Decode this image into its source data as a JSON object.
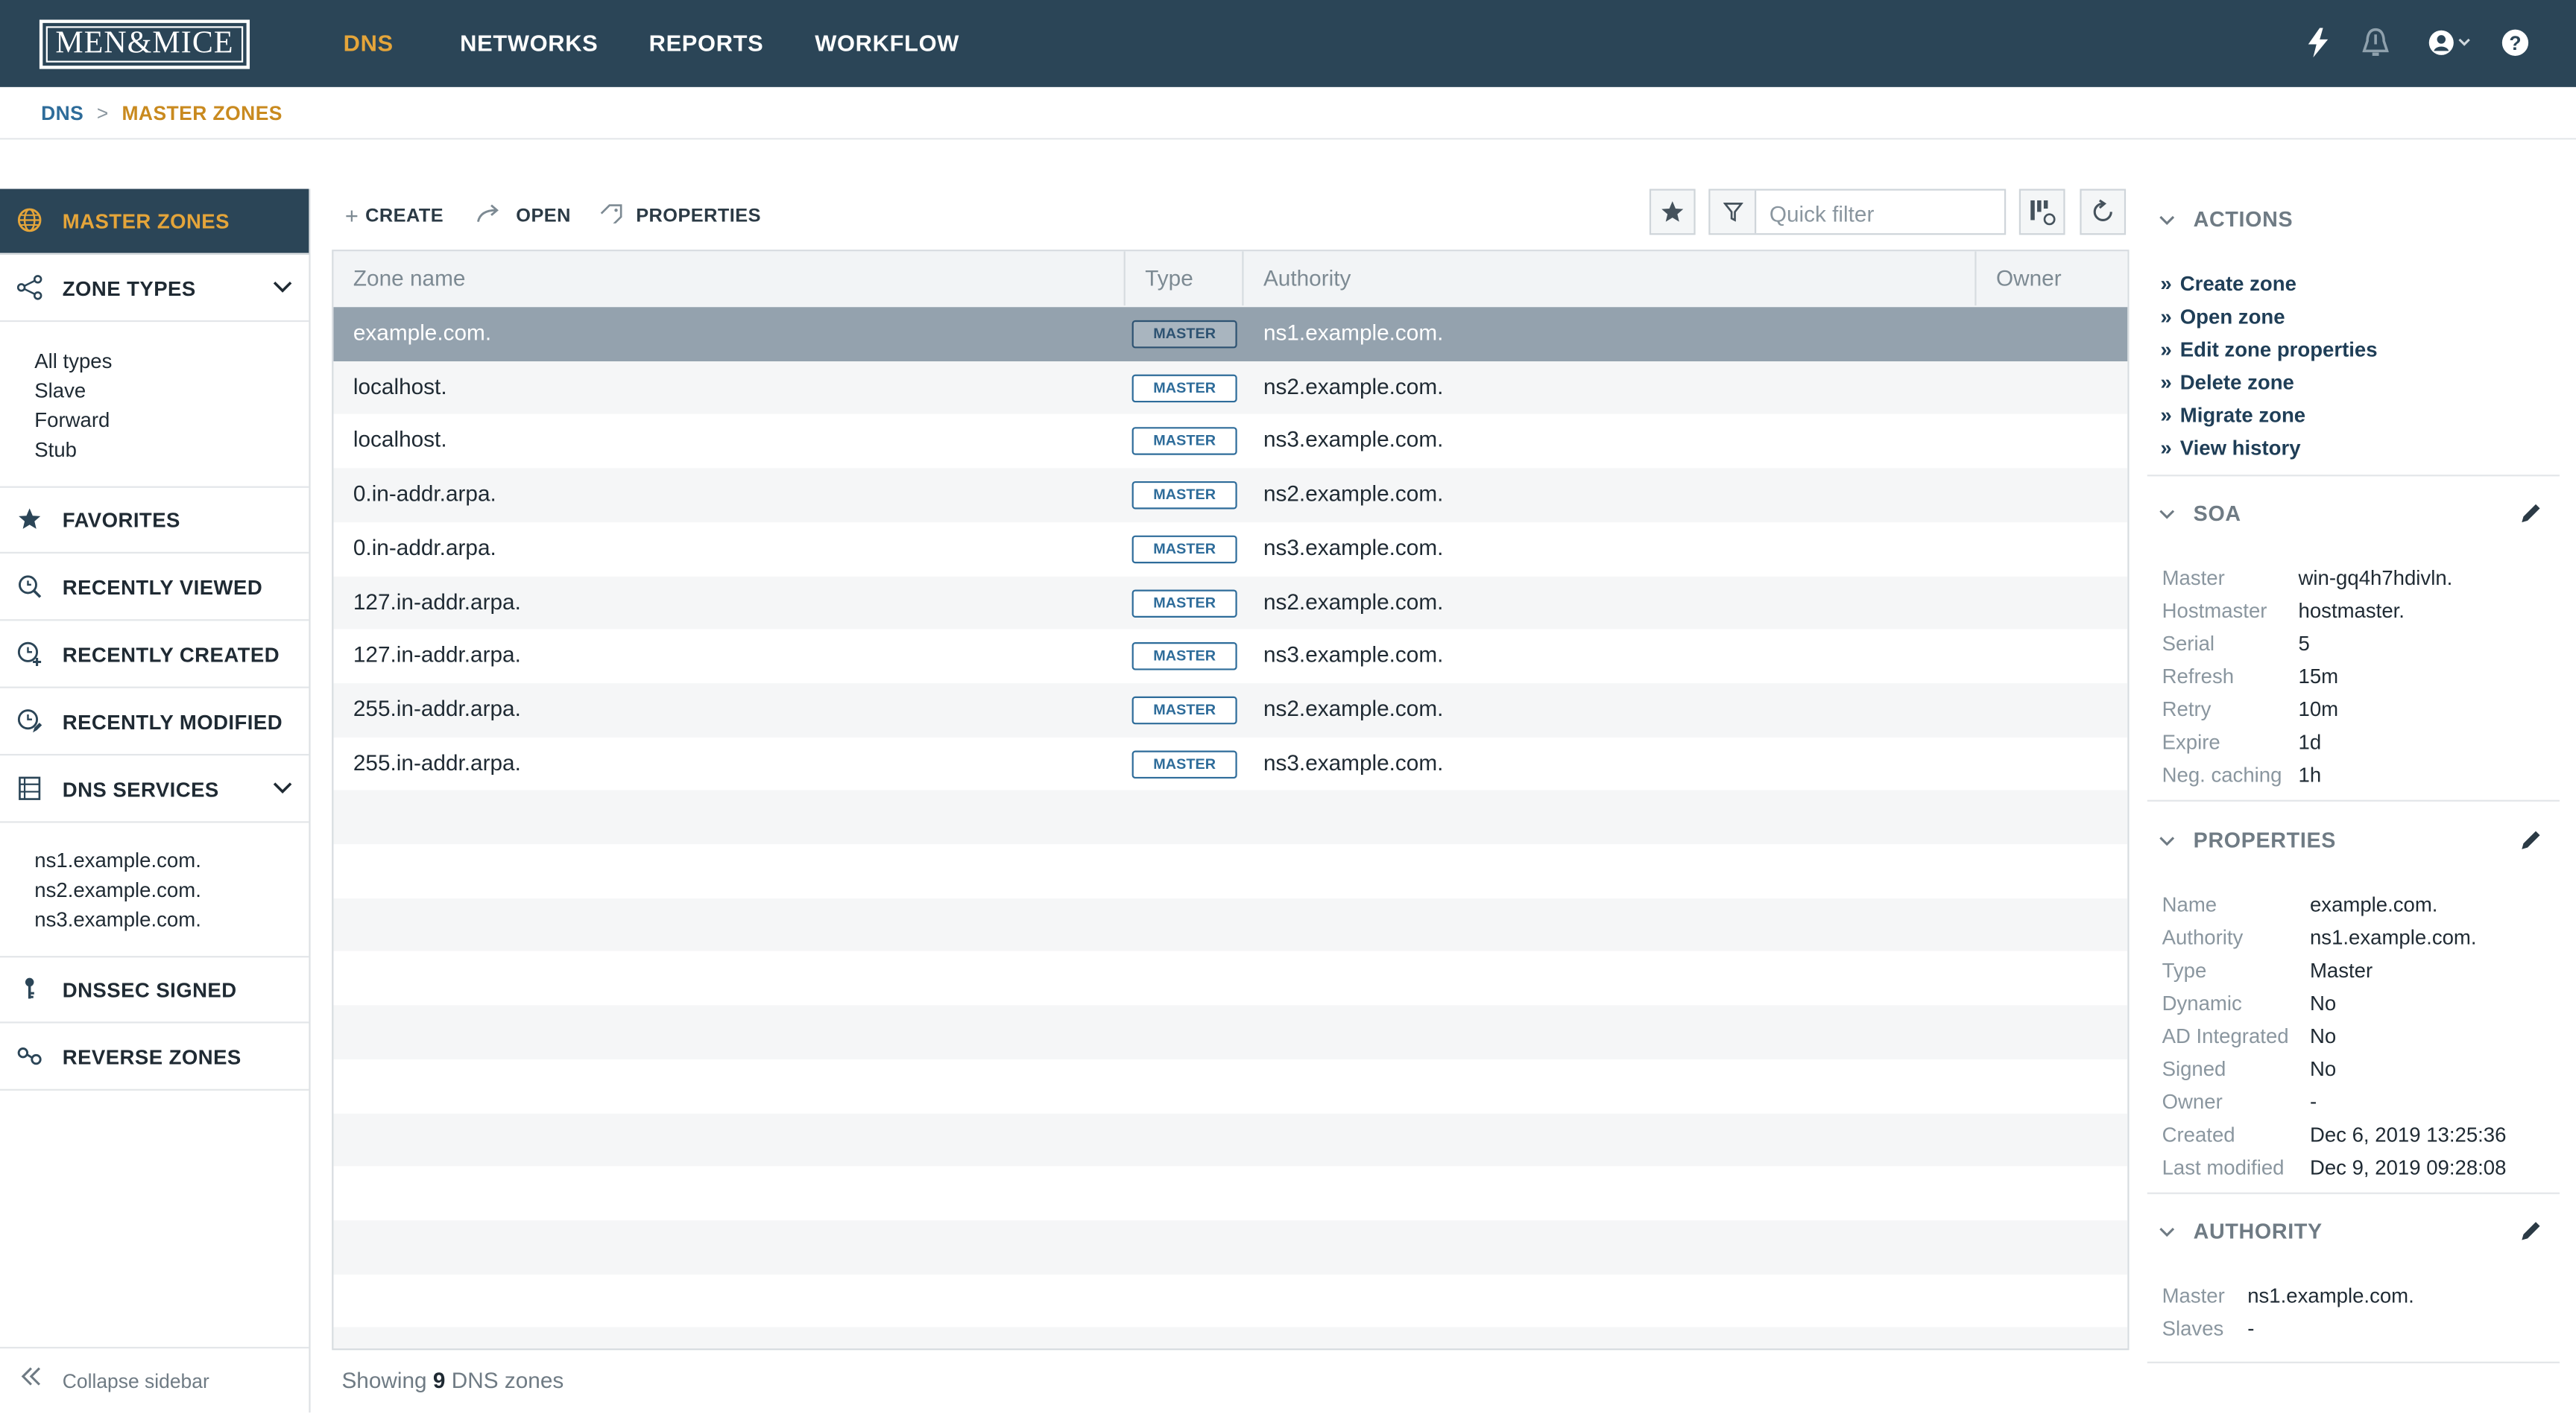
{
  "header": {
    "logo": "MEN&MICE",
    "nav": [
      "DNS",
      "NETWORKS",
      "REPORTS",
      "WORKFLOW"
    ],
    "active_nav": "DNS",
    "icons": [
      "lightning-icon",
      "bell-icon",
      "user-icon",
      "help-icon"
    ]
  },
  "breadcrumb": {
    "root": "DNS",
    "separator": ">",
    "current": "MASTER ZONES"
  },
  "sidebar": {
    "master_zones": "MASTER ZONES",
    "zone_types": {
      "label": "ZONE TYPES",
      "items": [
        "All types",
        "Slave",
        "Forward",
        "Stub"
      ]
    },
    "favorites": "FAVORITES",
    "recently_viewed": "RECENTLY VIEWED",
    "recently_created": "RECENTLY CREATED",
    "recently_modified": "RECENTLY MODIFIED",
    "dns_services": {
      "label": "DNS SERVICES",
      "items": [
        "ns1.example.com.",
        "ns2.example.com.",
        "ns3.example.com."
      ]
    },
    "dnssec_signed": "DNSSEC SIGNED",
    "reverse_zones": "REVERSE ZONES",
    "collapse": "Collapse sidebar"
  },
  "toolbar": {
    "create": "CREATE",
    "open": "OPEN",
    "properties": "PROPERTIES",
    "filter_placeholder": "Quick filter"
  },
  "grid": {
    "columns": [
      "Zone name",
      "Type",
      "Authority",
      "Owner"
    ],
    "rows": [
      {
        "zone": "example.com.",
        "type": "MASTER",
        "authority": "ns1.example.com.",
        "owner": ""
      },
      {
        "zone": "localhost.",
        "type": "MASTER",
        "authority": "ns2.example.com.",
        "owner": ""
      },
      {
        "zone": "localhost.",
        "type": "MASTER",
        "authority": "ns3.example.com.",
        "owner": ""
      },
      {
        "zone": "0.in-addr.arpa.",
        "type": "MASTER",
        "authority": "ns2.example.com.",
        "owner": ""
      },
      {
        "zone": "0.in-addr.arpa.",
        "type": "MASTER",
        "authority": "ns3.example.com.",
        "owner": ""
      },
      {
        "zone": "127.in-addr.arpa.",
        "type": "MASTER",
        "authority": "ns2.example.com.",
        "owner": ""
      },
      {
        "zone": "127.in-addr.arpa.",
        "type": "MASTER",
        "authority": "ns3.example.com.",
        "owner": ""
      },
      {
        "zone": "255.in-addr.arpa.",
        "type": "MASTER",
        "authority": "ns2.example.com.",
        "owner": ""
      },
      {
        "zone": "255.in-addr.arpa.",
        "type": "MASTER",
        "authority": "ns3.example.com.",
        "owner": ""
      }
    ],
    "selected_row": 0
  },
  "status": {
    "prefix": "Showing",
    "count": "9",
    "suffix": "DNS zones"
  },
  "actions": {
    "title": "ACTIONS",
    "items": [
      "Create zone",
      "Open zone",
      "Edit zone properties",
      "Delete zone",
      "Migrate zone",
      "View history"
    ]
  },
  "soa": {
    "title": "SOA",
    "fields": [
      {
        "k": "Master",
        "v": "win-gq4h7hdivln."
      },
      {
        "k": "Hostmaster",
        "v": "hostmaster."
      },
      {
        "k": "Serial",
        "v": "5"
      },
      {
        "k": "Refresh",
        "v": "15m"
      },
      {
        "k": "Retry",
        "v": "10m"
      },
      {
        "k": "Expire",
        "v": "1d"
      },
      {
        "k": "Neg. caching",
        "v": "1h"
      }
    ]
  },
  "properties": {
    "title": "PROPERTIES",
    "fields": [
      {
        "k": "Name",
        "v": "example.com."
      },
      {
        "k": "Authority",
        "v": "ns1.example.com."
      },
      {
        "k": "Type",
        "v": "Master"
      },
      {
        "k": "Dynamic",
        "v": "No"
      },
      {
        "k": "AD Integrated",
        "v": "No"
      },
      {
        "k": "Signed",
        "v": "No"
      },
      {
        "k": "Owner",
        "v": "-"
      },
      {
        "k": "Created",
        "v": "Dec 6, 2019 13:25:36"
      },
      {
        "k": "Last modified",
        "v": "Dec 9, 2019 09:28:08"
      }
    ]
  },
  "authority": {
    "title": "AUTHORITY",
    "fields": [
      {
        "k": "Master",
        "v": "ns1.example.com."
      },
      {
        "k": "Slaves",
        "v": "-"
      }
    ]
  }
}
